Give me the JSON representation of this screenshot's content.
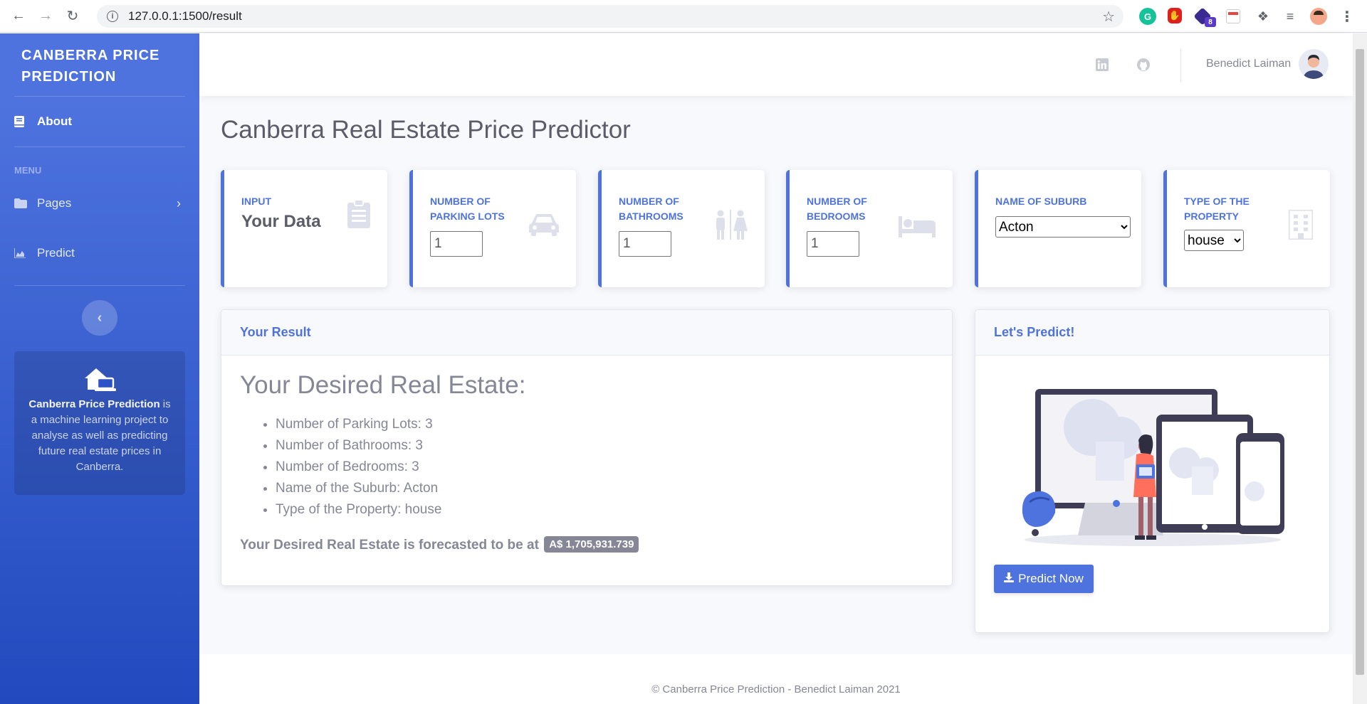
{
  "browser": {
    "url": "127.0.0.1:1500/result",
    "extension_badge": "8"
  },
  "sidebar": {
    "brand": "CANBERRA PRICE PREDICTION",
    "about_label": "About",
    "menu_heading": "MENU",
    "pages_label": "Pages",
    "predict_label": "Predict",
    "promo_title": "Canberra Price Prediction",
    "promo_text": "is a machine learning project to analyse as well as predicting future real estate prices in Canberra."
  },
  "topbar": {
    "user_name": "Benedict Laiman"
  },
  "page_title": "Canberra Real Estate Price Predictor",
  "cards": {
    "input": {
      "label": "INPUT",
      "value": "Your Data"
    },
    "parking": {
      "label": "NUMBER OF PARKING LOTS",
      "value": "1"
    },
    "bathrooms": {
      "label": "NUMBER OF BATHROOMS",
      "value": "1"
    },
    "bedrooms": {
      "label": "NUMBER OF BEDROOMS",
      "value": "1"
    },
    "suburb": {
      "label": "NAME OF SUBURB",
      "selected": "Acton"
    },
    "property": {
      "label": "TYPE OF THE PROPERTY",
      "selected": "house"
    }
  },
  "result": {
    "header": "Your Result",
    "title": "Your Desired Real Estate:",
    "items": [
      "Number of Parking Lots: 3",
      "Number of Bathrooms: 3",
      "Number of Bedrooms: 3",
      "Name of the Suburb: Acton",
      "Type of the Property: house"
    ],
    "forecast_text": "Your Desired Real Estate is forecasted to be at",
    "forecast_value": "A$ 1,705,931.739"
  },
  "predict": {
    "header": "Let's Predict!",
    "button_label": "Predict Now"
  },
  "footer": {
    "text": "© Canberra Price Prediction - Benedict Laiman 2021"
  },
  "colors": {
    "primary": "#4e73df",
    "sidebar_dark": "#224abe",
    "text": "#858796",
    "badge": "#858796"
  }
}
